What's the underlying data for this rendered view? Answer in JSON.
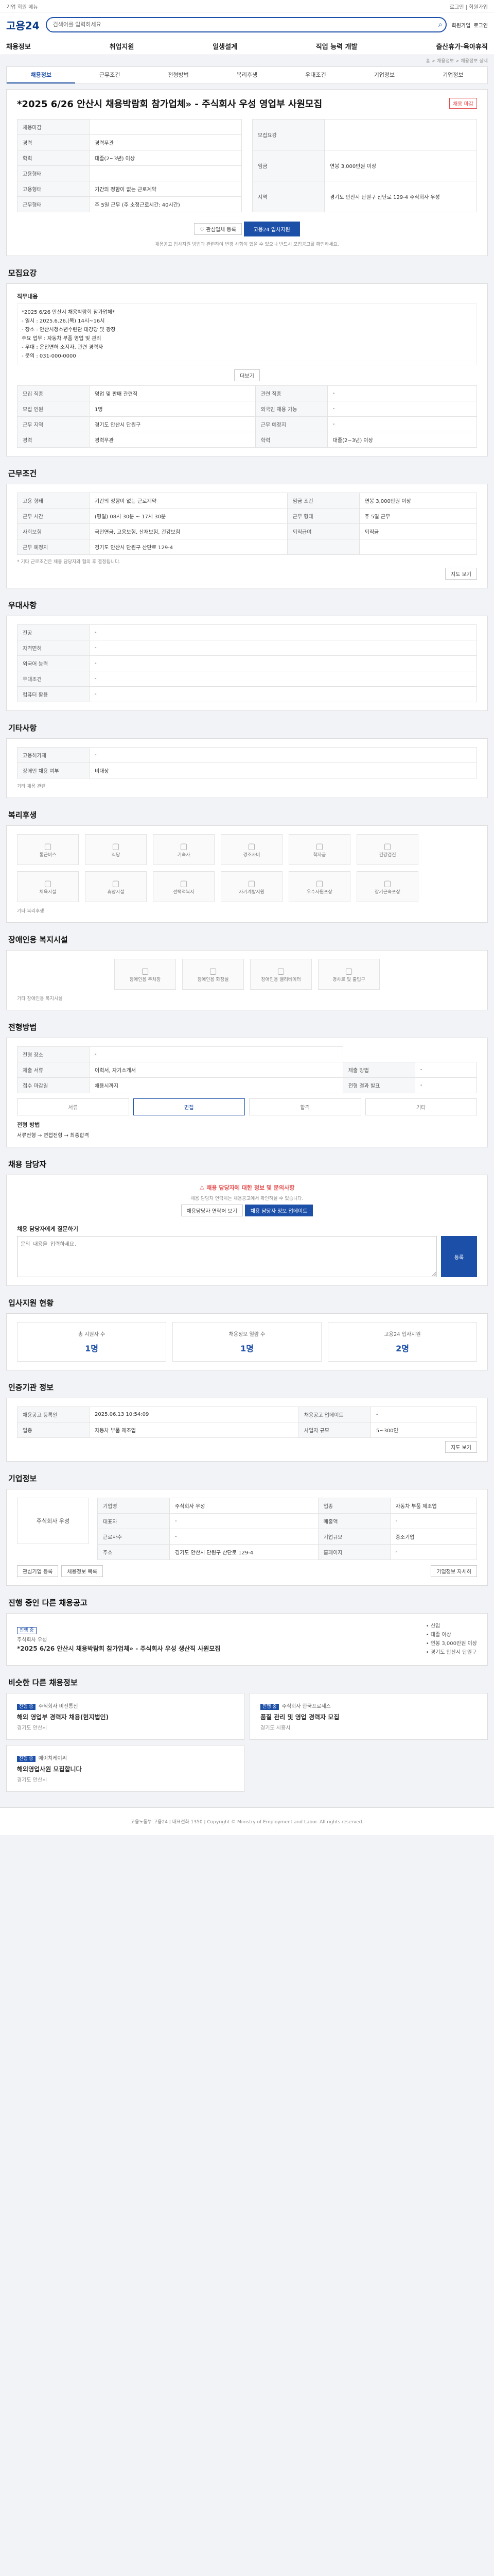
{
  "topbar": {
    "left": "기업 회원 메뉴",
    "right": "로그인 | 회원가입"
  },
  "header": {
    "logo": "고용24",
    "search_placeholder": "검색어를 입력하세요",
    "links": [
      "회원가입",
      "로그인"
    ]
  },
  "gnb": [
    "채용정보",
    "취업지원",
    "일생설계",
    "직업 능력 개발",
    "출산휴가·육아휴직"
  ],
  "breadcrumb": "홈 > 채용정보 > 채용정보 상세",
  "tabs": [
    "채용정보",
    "근무조건",
    "전형방법",
    "복리후생",
    "우대조건",
    "기업정보",
    "기업정보"
  ],
  "posting": {
    "title": "*2025 6/26 안산시 채용박람회 참가업체» - 주식회사 우성 영업부 사원모집",
    "badge": "채용 마감",
    "cols": {
      "left": [
        {
          "label": "채용마감",
          "value": ""
        },
        {
          "label": "경력",
          "value": "경력무관"
        },
        {
          "label": "학력",
          "value": "대졸(2~3년) 이상"
        },
        {
          "label": "고용형태",
          "value": ""
        },
        {
          "label": "고용형태",
          "value": "기간의 정함이 없는 근로계약"
        },
        {
          "label": "근무형태",
          "value": "주 5일 근무 (주 소정근로시간: 40시간)"
        }
      ],
      "right": [
        {
          "label": "모집요강",
          "value": ""
        },
        {
          "label": "임금",
          "value": "연봉 3,000만원 이상"
        },
        {
          "label": "지역",
          "value": "경기도 안산시 단원구 산단로 129-4 주식회사 우성"
        }
      ]
    },
    "buttons": {
      "interest": "관심업체 등록",
      "apply": "고용24 입사지원"
    },
    "notice": "채용공고 입사지원 방법과 관련하여 변경 사항이 있을 수 있으니 반드시 모집공고를 확인하세요."
  },
  "recruit": {
    "title": "모집요강",
    "job_title": "직무내용",
    "job_desc": [
      "*2025 6/26 안산시 채용박람회 참가업체*",
      "- 일시 : 2025.6.26.(목) 14시~16시",
      "- 장소 : 안산시청소년수련관 대강당 및 광장",
      "주요 업무 : 자동차 부품 영업 및 관리",
      "- 우대 : 운전면허 소지자, 관련 경력자",
      "- 문의 : 031-000-0000"
    ],
    "more": "더보기",
    "rows": [
      [
        "모집 직종",
        "영업 및 판매 관련직",
        "관련 직종",
        "-"
      ],
      [
        "모집 인원",
        "1명",
        "외국인 채용 가능",
        "-"
      ],
      [
        "근무 지역",
        "경기도 안산시 단원구",
        "근무 예정지",
        "-"
      ]
    ],
    "rows2": [
      [
        "경력",
        "경력무관",
        "학력",
        "대졸(2~3년) 이상"
      ]
    ]
  },
  "work": {
    "title": "근무조건",
    "rows": [
      [
        "고용 형태",
        "기간의 정함이 없는 근로계약",
        "임금 조건",
        "연봉 3,000만원 이상"
      ],
      [
        "근무 시간",
        "(평일) 08시 30분 ~ 17시 30분",
        "근무 형태",
        "주 5일 근무"
      ],
      [
        "사회보험",
        "국민연금, 고용보험, 산재보험, 건강보험",
        "퇴직급여",
        "퇴직금"
      ],
      [
        "근무 예정지",
        "경기도 안산시 단원구 산단로 129-4",
        "",
        ""
      ]
    ],
    "note": "* 기타 근로조건은 채용 담당자와 협의 후 결정됩니다.",
    "map_btn": "지도 보기"
  },
  "prefer": {
    "title": "우대사항",
    "rows": [
      [
        "전공",
        "-"
      ],
      [
        "자격면허",
        "-"
      ],
      [
        "외국어 능력",
        "-"
      ],
      [
        "우대조건",
        "-"
      ],
      [
        "컴퓨터 활용",
        "-"
      ]
    ]
  },
  "extra": {
    "title": "기타사항",
    "rows": [
      [
        "고용허가제",
        "-"
      ],
      [
        "장애인 채용 여부",
        "비대상"
      ]
    ],
    "link": "기타 채용 관련"
  },
  "welfare": {
    "title": "복리후생",
    "items": [
      "통근버스",
      "식당",
      "기숙사",
      "경조사비",
      "학자금",
      "건강검진",
      "체육시설",
      "휴양시설",
      "선택적복지",
      "자기계발지원",
      "우수사원포상",
      "장기근속포상"
    ],
    "note": "기타 복리후생"
  },
  "facility": {
    "title": "장애인용 복지시설",
    "items": [
      "장애인용 주차장",
      "장애인용 화장실",
      "장애인용 엘리베이터",
      "경사로 및 출입구"
    ],
    "note": "기타 장애인용 복지시설"
  },
  "process": {
    "title": "전형방법",
    "rows": [
      [
        "전형 장소",
        "-"
      ],
      [
        "제출 서류",
        "이력서, 자기소개서",
        "제출 방법",
        "-"
      ],
      [
        "접수 마감일",
        "채용시까지",
        "전형 결과 발표",
        "-"
      ]
    ],
    "steps": [
      "서류",
      "면접",
      "합격",
      "기타"
    ],
    "method_title": "전형 방법",
    "method": "서류전형 → 면접전형 → 최종합격"
  },
  "contact": {
    "title": "채용 담당자",
    "alert": "채용 담당자에 대한 정보 및 문의사항",
    "desc": "채용 담당자 연락처는 채용공고에서 확인하실 수 있습니다.",
    "btn1": "채용담당자 연락처 보기",
    "btn2": "채용 담당자 정보 업데이트",
    "q_title": "채용 담당자에게 질문하기",
    "q_placeholder": "문의 내용을 입력하세요.",
    "q_btn": "등록"
  },
  "status": {
    "title": "입사지원 현황",
    "apply_cnt": {
      "label": "총 지원자 수",
      "value": "1명"
    },
    "view_cnt": {
      "label": "채용정보 열람 수",
      "value": "1명"
    },
    "pass_cnt": {
      "label": "고용24 입사지원",
      "value": "2명"
    }
  },
  "agency": {
    "title": "인증기관 정보",
    "rows": [
      [
        "채용공고 등록일",
        "2025.06.13 10:54:09",
        "채용공고 업데이트",
        "-"
      ],
      [
        "업종",
        "자동차 부품 제조업",
        "사업자 규모",
        "5~300인"
      ]
    ],
    "btn": "지도 보기"
  },
  "company": {
    "title": "기업정보",
    "name": "주식회사 우성",
    "rows": [
      [
        "기업명",
        "주식회사 우성",
        "업종",
        "자동차 부품 제조업"
      ],
      [
        "대표자",
        "-",
        "매출액",
        "-"
      ],
      [
        "근로자수",
        "-",
        "기업규모",
        "중소기업"
      ],
      [
        "주소",
        "경기도 안산시 단원구 산단로 129-4",
        "홈페이지",
        "-"
      ]
    ],
    "btn": "기업정보 자세히",
    "btn_interest": "관심기업 등록",
    "btn_list": "채용정보 목록"
  },
  "other": {
    "title": "진행 중인 다른 채용공고",
    "item_title": "*2025 6/26 안산시 채용박람회 참가업체» - 주식회사 우성 생산직 사원모집",
    "company": "주식회사 우성",
    "meta": [
      "신입",
      "대졸 이상",
      "연봉 3,000만원 이상",
      "경기도 안산시 단원구"
    ],
    "badge": "진행 중"
  },
  "similar": {
    "title": "비슷한 다른 채용정보",
    "items": [
      {
        "tag": "진행 중",
        "company": "주식회사 비전통신",
        "title": "해외 영업부 경력자 채용(현지법인)",
        "loc": "경기도 안산시"
      },
      {
        "tag": "진행 중",
        "company": "주식회사 한국프로세스",
        "title": "품질 관리 및 영업 경력자 모집",
        "loc": "경기도 시흥시"
      },
      {
        "tag": "진행 중",
        "company": "에이치케이씨",
        "title": "해외영업사원 모집합니다",
        "loc": "경기도 안산시"
      }
    ]
  },
  "footer": "고용노동부 고용24 | 대표전화 1350 | Copyright © Ministry of Employment and Labor. All rights reserved."
}
